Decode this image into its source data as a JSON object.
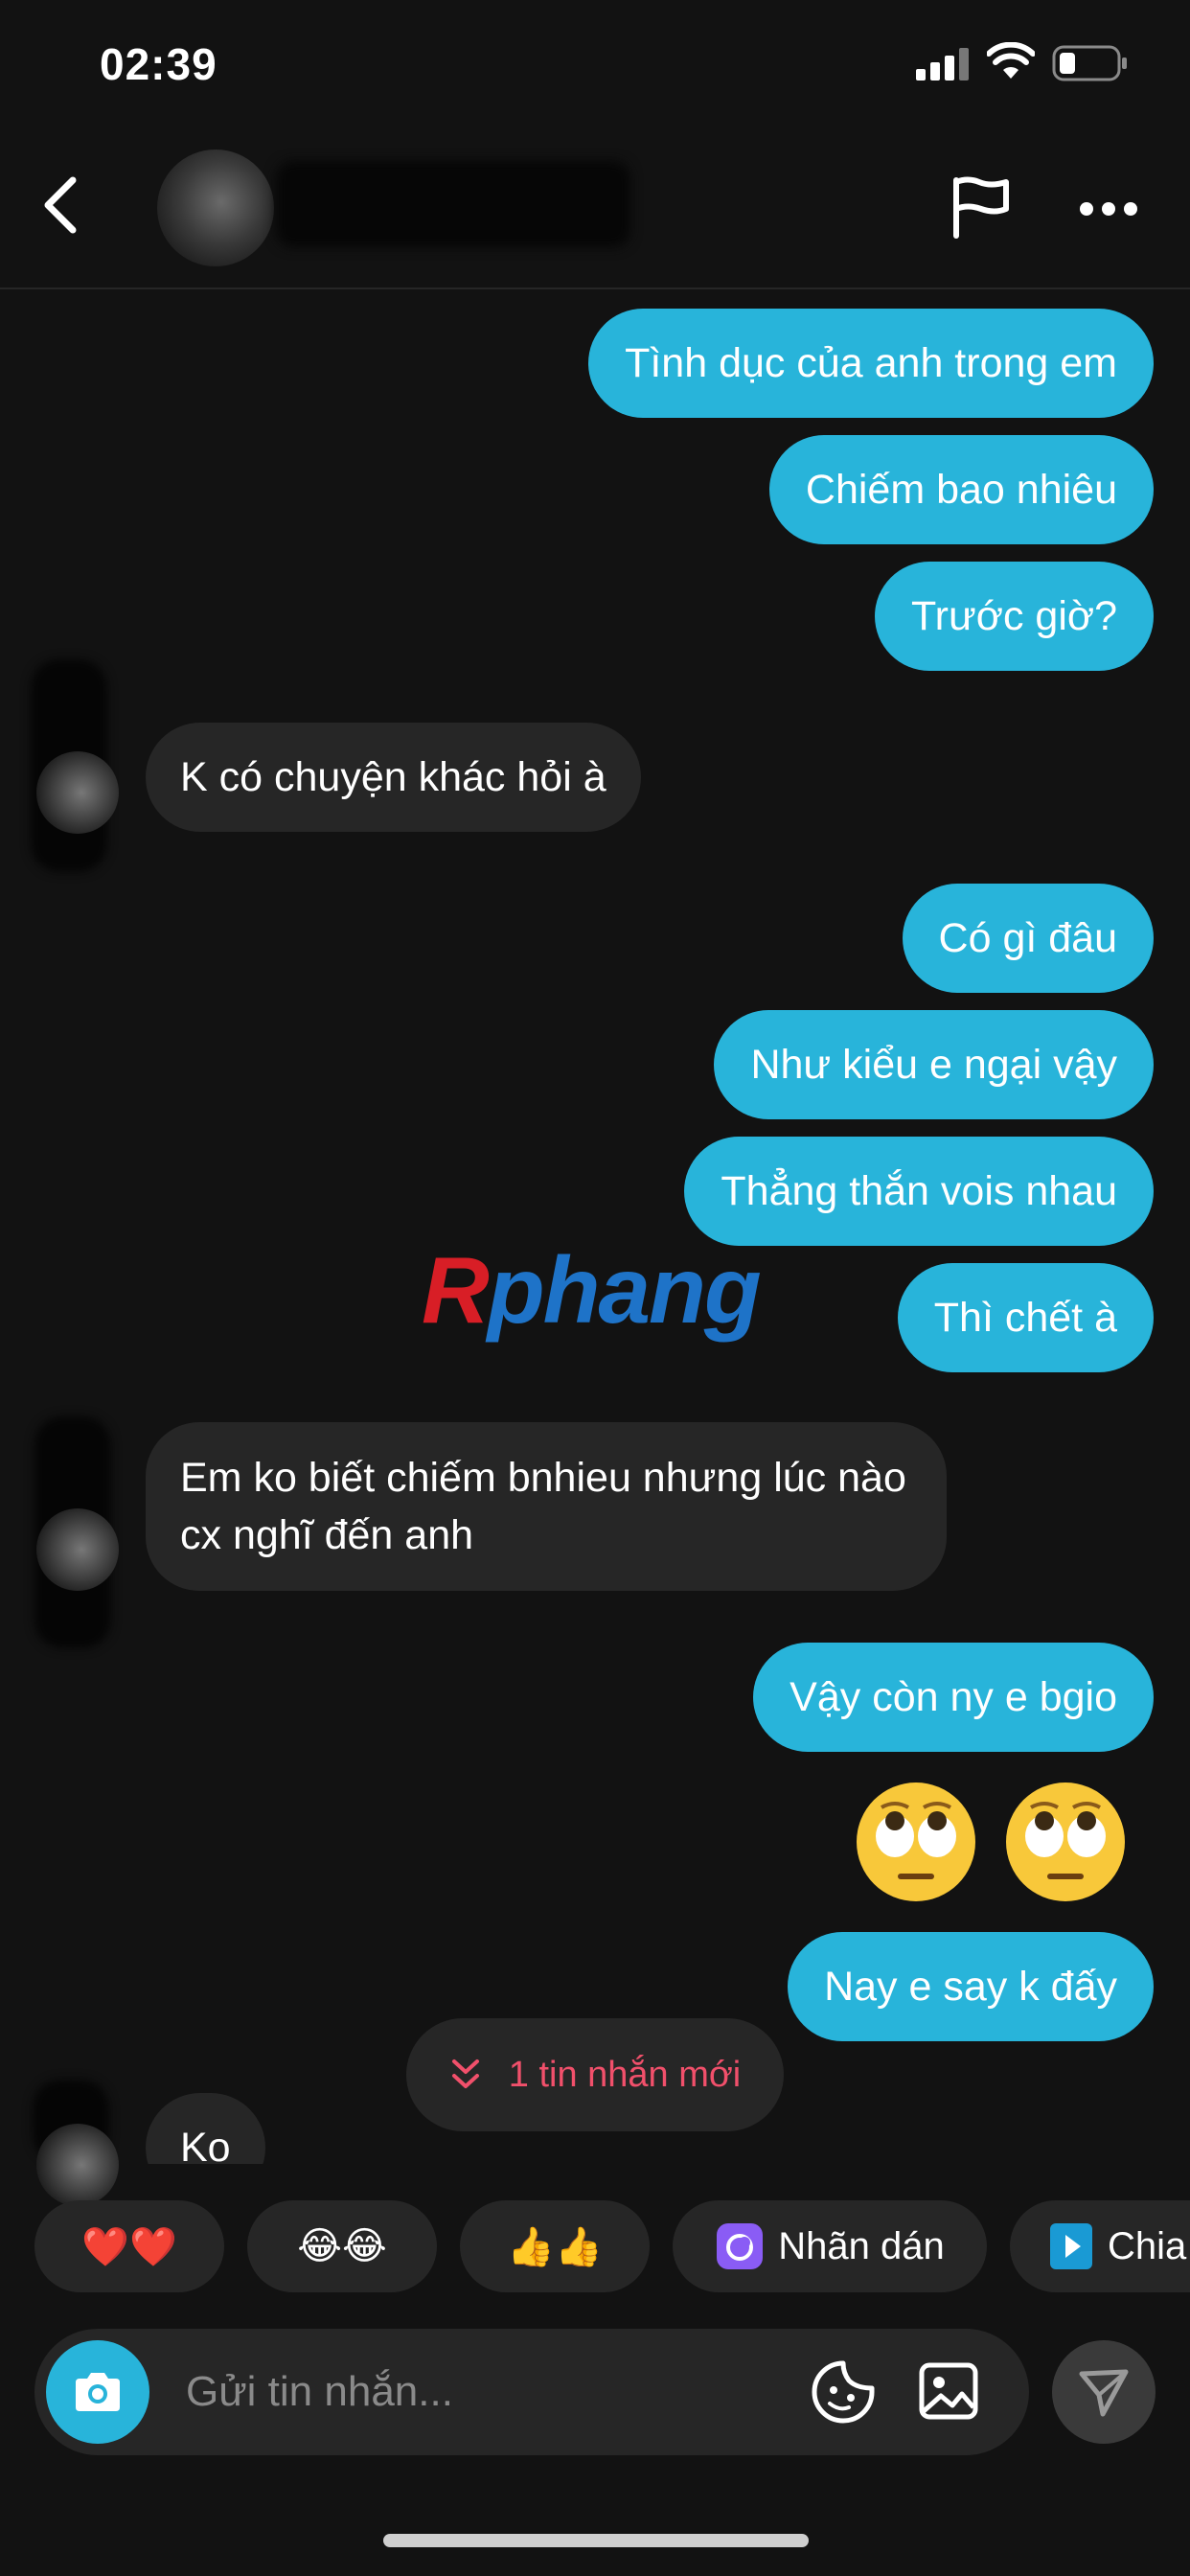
{
  "status_bar": {
    "time": "02:39"
  },
  "header": {
    "contact_name": ""
  },
  "messages": [
    {
      "type": "sent",
      "text": "Tình dục của anh trong em"
    },
    {
      "type": "sent",
      "text": "Chiếm bao nhiêu"
    },
    {
      "type": "sent",
      "text": "Trước giờ?"
    },
    {
      "type": "received",
      "text": "K có chuyện khác hỏi à"
    },
    {
      "type": "sent",
      "text": "Có gì đâu"
    },
    {
      "type": "sent",
      "text": "Như kiểu e ngại vậy"
    },
    {
      "type": "sent",
      "text": "Thẳng thắn vois nhau"
    },
    {
      "type": "sent",
      "text": "Thì chết à"
    },
    {
      "type": "received",
      "text": "Em ko biết chiếm bnhieu nhưng lúc nào cx nghĩ đến anh"
    },
    {
      "type": "sent",
      "text": "Vậy còn ny e bgio"
    },
    {
      "type": "sent_emoji",
      "emoji": [
        "eye-roll-emoji",
        "eye-roll-emoji"
      ]
    },
    {
      "type": "sent",
      "text": "Nay e say k đấy"
    },
    {
      "type": "received",
      "text": "Ko"
    }
  ],
  "new_messages_pill": "1 tin nhắn mới",
  "watermark": {
    "first": "R",
    "rest": "phang"
  },
  "quick_replies": [
    {
      "label": "❤️❤️",
      "icon": "heart-emoji"
    },
    {
      "label": "😂😂",
      "icon": "laughing-emoji"
    },
    {
      "label": "👍👍",
      "icon": "thumbs-up-emoji"
    },
    {
      "label": "Nhãn dán",
      "icon": "sticker-icon"
    },
    {
      "label": "Chia",
      "icon": "share-icon"
    }
  ],
  "composer": {
    "placeholder": "Gửi tin nhắn..."
  },
  "colors": {
    "sent_bubble": "#28b4da",
    "received_bubble": "#262626",
    "background": "#121212",
    "new_pill_text": "#f1506b"
  }
}
